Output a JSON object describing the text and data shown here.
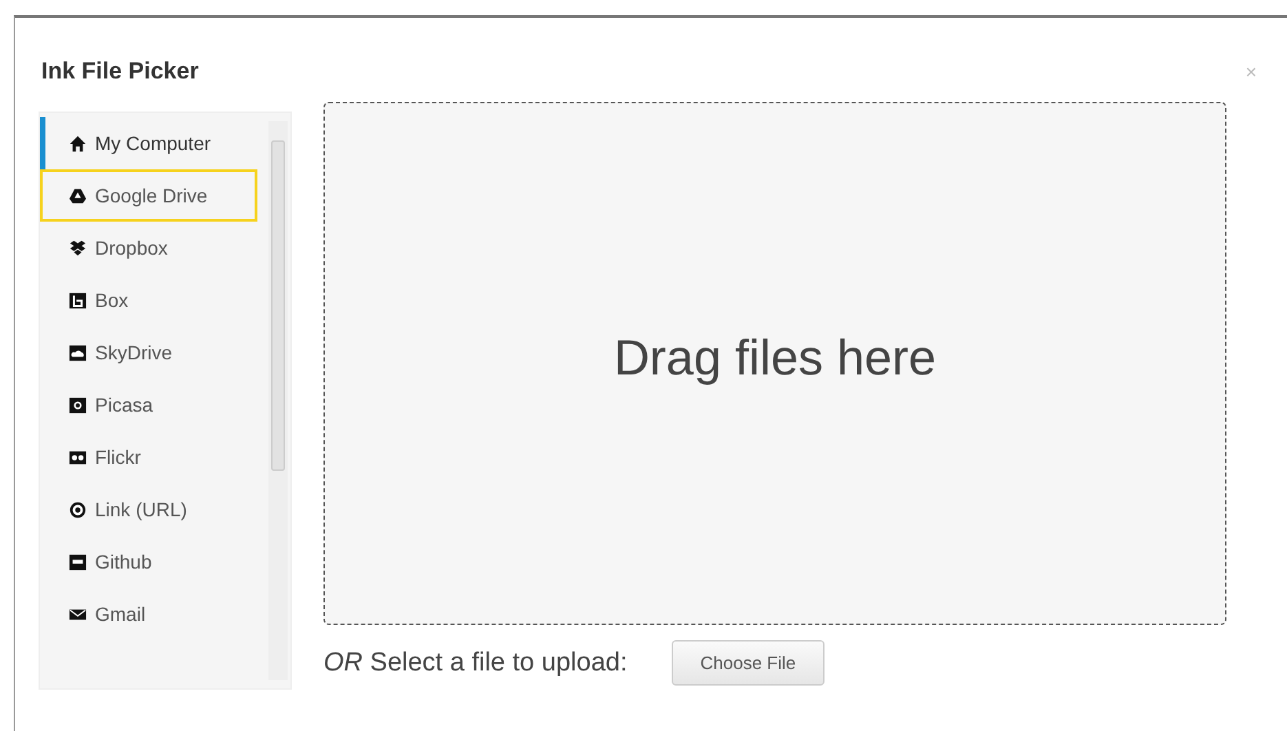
{
  "window": {
    "title": "Ink File Picker",
    "close": "×"
  },
  "sidebar": {
    "items": [
      {
        "label": "My Computer",
        "kind": "home",
        "selected": true,
        "focused": false
      },
      {
        "label": "Google Drive",
        "kind": "triangle",
        "selected": false,
        "focused": true
      },
      {
        "label": "Dropbox",
        "kind": "boxes",
        "selected": false,
        "focused": false
      },
      {
        "label": "Box",
        "kind": "square",
        "selected": false,
        "focused": false
      },
      {
        "label": "SkyDrive",
        "kind": "cloud",
        "selected": false,
        "focused": false
      },
      {
        "label": "Picasa",
        "kind": "camera",
        "selected": false,
        "focused": false
      },
      {
        "label": "Flickr",
        "kind": "dots",
        "selected": false,
        "focused": false
      },
      {
        "label": "Link (URL)",
        "kind": "ring",
        "selected": false,
        "focused": false
      },
      {
        "label": "Github",
        "kind": "bar",
        "selected": false,
        "focused": false
      },
      {
        "label": "Gmail",
        "kind": "mail",
        "selected": false,
        "focused": false
      }
    ]
  },
  "dropzone": {
    "text": "Drag files here"
  },
  "upload": {
    "prefix": "OR",
    "label": "Select a file to upload:",
    "button": "Choose File"
  }
}
